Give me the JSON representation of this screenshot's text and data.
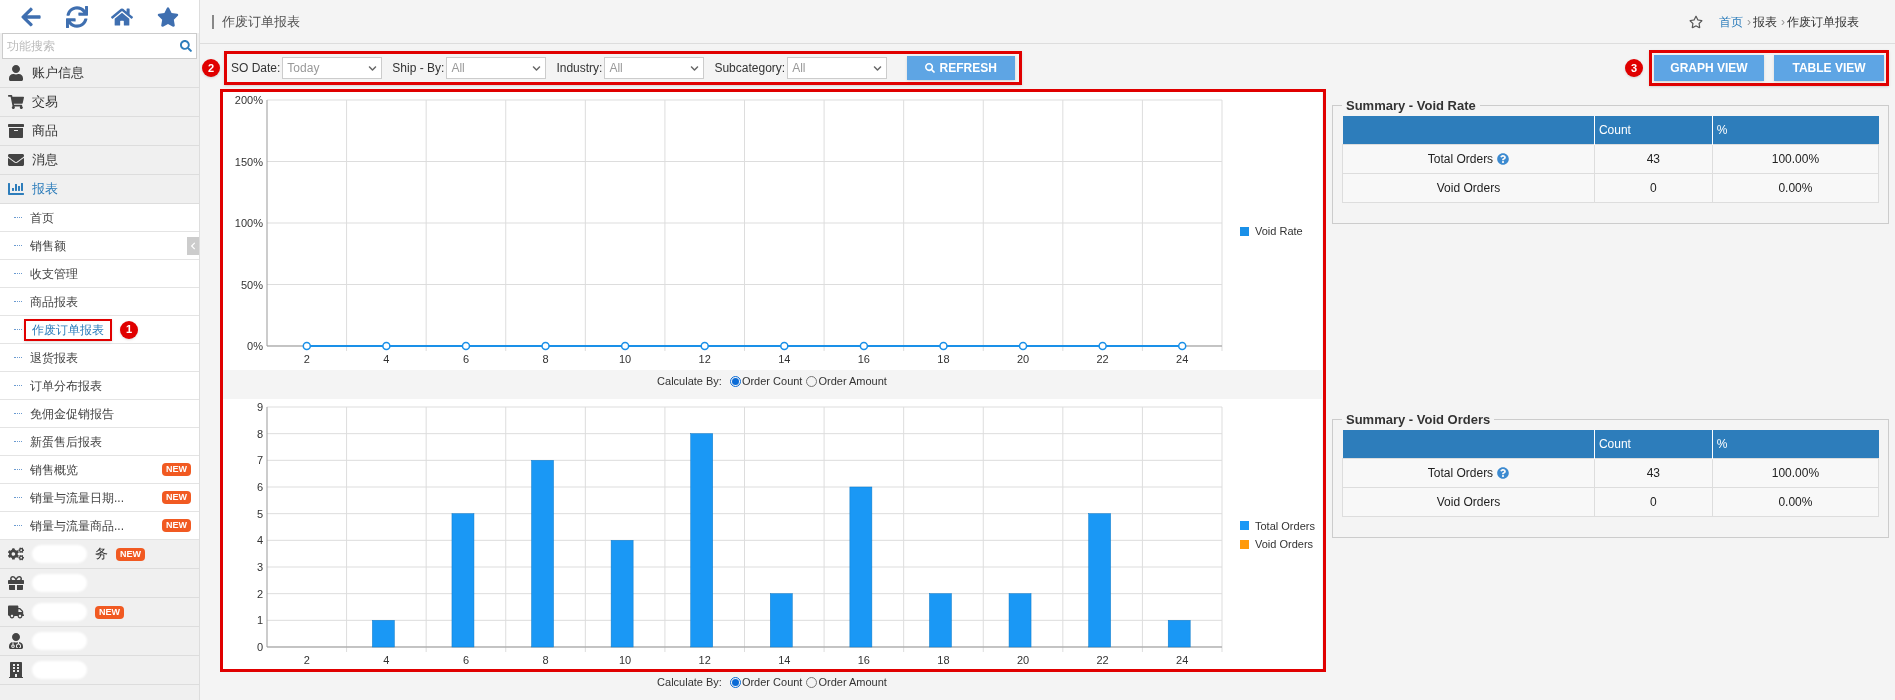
{
  "sidebar": {
    "search": {
      "placeholder": "功能搜索"
    },
    "items": [
      {
        "label": "账户信息",
        "selected": false
      },
      {
        "label": "交易",
        "selected": false
      },
      {
        "label": "商品",
        "selected": false
      },
      {
        "label": "消息",
        "selected": false
      },
      {
        "label": "报表",
        "selected": true,
        "expanded": true,
        "children": [
          {
            "label": "首页",
            "selected": false
          },
          {
            "label": "销售额",
            "selected": false
          },
          {
            "label": "收支管理",
            "selected": false
          },
          {
            "label": "商品报表",
            "selected": false
          },
          {
            "label": "作废订单报表",
            "selected": true,
            "callout": "1"
          },
          {
            "label": "退货报表",
            "selected": false
          },
          {
            "label": "订单分布报表",
            "selected": false
          },
          {
            "label": "免佣金促销报告",
            "selected": false
          },
          {
            "label": "新蛋售后报表",
            "selected": false
          },
          {
            "label": "销售概览",
            "selected": false,
            "badge": "NEW"
          },
          {
            "label": "销量与流量日期...",
            "selected": false,
            "badge": "NEW"
          },
          {
            "label": "销量与流量商品...",
            "selected": false,
            "badge": "NEW"
          }
        ]
      },
      {
        "label": "务",
        "selected": false,
        "blurred": true,
        "badge": "NEW"
      },
      {
        "selected": false,
        "blurred": true
      },
      {
        "selected": false,
        "blurred": true,
        "badge": "NEW"
      },
      {
        "selected": false,
        "blurred": true
      },
      {
        "selected": false,
        "blurred": true
      }
    ]
  },
  "header": {
    "title": "作废订单报表",
    "breadcrumb": [
      {
        "label": "首页"
      },
      {
        "separator": "›",
        "label": "报表"
      },
      {
        "separator": "›",
        "label": "作废订单报表"
      }
    ]
  },
  "filters": {
    "callout": "2",
    "fields": [
      {
        "label": "SO Date:",
        "value": "Today"
      },
      {
        "label": "Ship - By:",
        "value": "All"
      },
      {
        "label": "Industry:",
        "value": "All"
      },
      {
        "label": "Subcategory:",
        "value": "All"
      }
    ],
    "refresh": "REFRESH"
  },
  "views": {
    "callout": "3",
    "buttons": [
      "GRAPH VIEW",
      "TABLE VIEW"
    ]
  },
  "sections": [
    {
      "chart_data": {
        "type": "line",
        "grid": true,
        "categories": [
          "2",
          "4",
          "6",
          "8",
          "10",
          "12",
          "14",
          "16",
          "18",
          "20",
          "22",
          "24"
        ],
        "series": [
          {
            "name": "Void Rate",
            "color": "#1a90e8",
            "marker": "circle",
            "values": [
              0,
              0,
              0,
              0,
              0,
              0,
              0,
              0,
              0,
              0,
              0,
              0
            ]
          }
        ],
        "ylim": [
          0,
          200
        ],
        "yticks": [
          {
            "value": 0,
            "label": "0%"
          },
          {
            "value": 50,
            "label": "50%"
          },
          {
            "value": 100,
            "label": "100%"
          },
          {
            "value": 150,
            "label": "150%"
          },
          {
            "value": 200,
            "label": "200%"
          }
        ]
      },
      "calculate_by": {
        "label": "Calculate By:",
        "options": [
          {
            "label": "Order Count",
            "selected": true
          },
          {
            "label": "Order Amount",
            "selected": false
          }
        ]
      },
      "summary": {
        "title": "Summary - Void Rate",
        "columns": [
          "Count",
          "%"
        ],
        "rows": [
          {
            "label": "Total Orders",
            "help": true,
            "count": "43",
            "percent": "100.00%"
          },
          {
            "label": "Void Orders",
            "help": false,
            "count": "0",
            "percent": "0.00%"
          }
        ]
      }
    },
    {
      "chart_data": {
        "type": "bar",
        "grid": true,
        "categories": [
          "2",
          "4",
          "6",
          "8",
          "10",
          "12",
          "14",
          "16",
          "18",
          "20",
          "22",
          "24"
        ],
        "series": [
          {
            "name": "Total Orders",
            "color": "#1a98f5",
            "values": [
              0,
              1,
              5,
              7,
              4,
              8,
              2,
              6,
              2,
              2,
              5,
              1
            ]
          },
          {
            "name": "Void Orders",
            "color": "#ff9a0a",
            "values": [
              0,
              0,
              0,
              0,
              0,
              0,
              0,
              0,
              0,
              0,
              0,
              0
            ]
          }
        ],
        "ylim": [
          0,
          9
        ],
        "yticks": [
          0,
          1,
          2,
          3,
          4,
          5,
          6,
          7,
          8,
          9
        ]
      },
      "calculate_by": {
        "label": "Calculate By:",
        "options": [
          {
            "label": "Order Count",
            "selected": true
          },
          {
            "label": "Order Amount",
            "selected": false
          }
        ]
      },
      "summary": {
        "title": "Summary - Void Orders",
        "columns": [
          "Count",
          "%"
        ],
        "rows": [
          {
            "label": "Total Orders",
            "help": true,
            "count": "43",
            "percent": "100.00%"
          },
          {
            "label": "Void Orders",
            "help": false,
            "count": "0",
            "percent": "0.00%"
          }
        ]
      }
    }
  ]
}
